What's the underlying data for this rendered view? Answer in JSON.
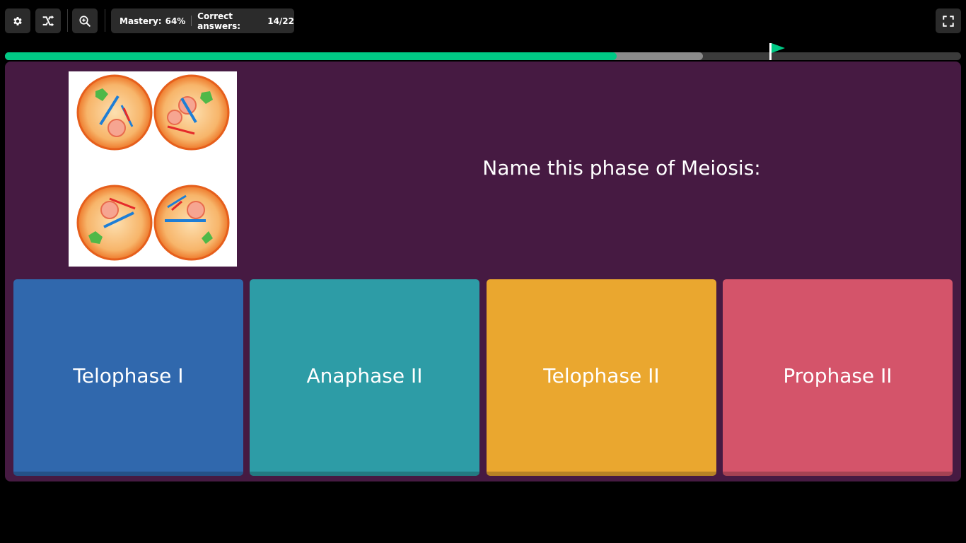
{
  "toolbar": {
    "settings_icon": "gear-icon",
    "powerups_icon": "shuffle-icon",
    "zoom_icon": "zoom-in-icon",
    "fullscreen_icon": "fullscreen-icon"
  },
  "stats": {
    "mastery_label": "Mastery:",
    "mastery_value": "64%",
    "correct_label": "Correct answers:",
    "correct_value": "14/22"
  },
  "progress": {
    "completed_fraction": 0.64,
    "attempted_fraction": 0.73,
    "goal_fraction": 0.8,
    "colors": {
      "completed": "#00c985",
      "attempted": "#8b8b8b",
      "track": "#3b3b3b"
    }
  },
  "question": {
    "text": "Name this phase of Meiosis:",
    "image_subject": "meiosis-cells-illustration"
  },
  "options": [
    {
      "label": "Telophase I",
      "color": "#3068ad"
    },
    {
      "label": "Anaphase II",
      "color": "#2d9ca6"
    },
    {
      "label": "Telophase II",
      "color": "#eaa72f"
    },
    {
      "label": "Prophase II",
      "color": "#d4546a"
    }
  ],
  "theme": {
    "panel": "#461a42",
    "background": "#000000"
  }
}
